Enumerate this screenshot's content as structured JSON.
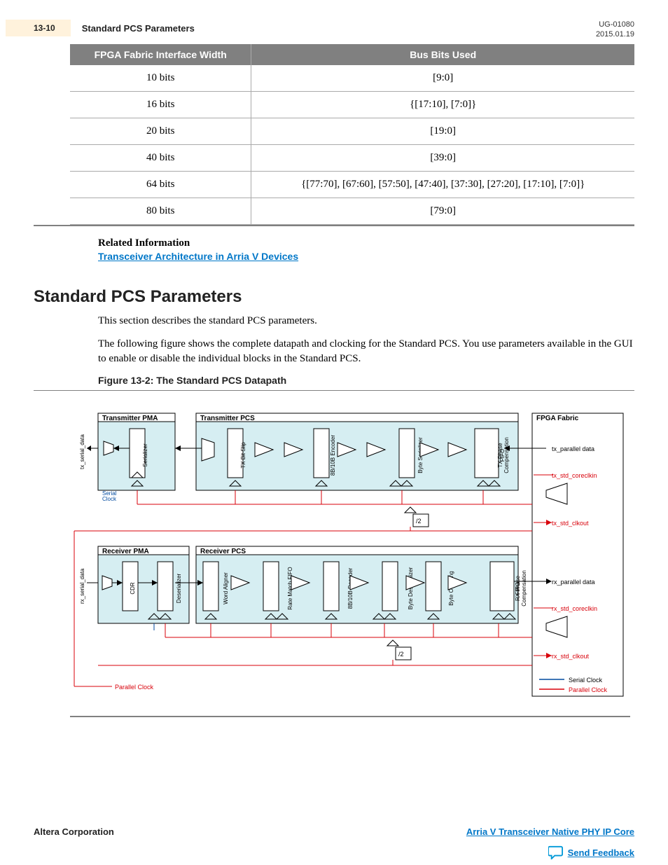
{
  "header": {
    "page_num": "13-10",
    "section_small": "Standard PCS Parameters",
    "doc_id": "UG-01080",
    "doc_date": "2015.01.19"
  },
  "table": {
    "headers": [
      "FPGA Fabric Interface Width",
      "Bus Bits Used"
    ],
    "rows": [
      [
        "10 bits",
        "[9:0]"
      ],
      [
        "16 bits",
        "{[17:10], [7:0]}"
      ],
      [
        "20 bits",
        "[19:0]"
      ],
      [
        "40 bits",
        "[39:0]"
      ],
      [
        "64 bits",
        "{[77:70], [67:60], [57:50], [47:40], [37:30], [27:20], [17:10], [7:0]}"
      ],
      [
        "80 bits",
        "[79:0]"
      ]
    ]
  },
  "related": {
    "heading": "Related Information",
    "link": "Transceiver Architecture in Arria V Devices"
  },
  "section": {
    "title": "Standard PCS Parameters",
    "para1": "This section describes the standard PCS parameters.",
    "para2": "The following figure shows the complete datapath and clocking for the Standard PCS. You use parameters available in the GUI to enable or disable the individual blocks in the Standard PCS."
  },
  "figure": {
    "caption": "Figure 13-2: The Standard PCS Datapath",
    "labels": {
      "tx_pma": "Transmitter PMA",
      "tx_pcs": "Transmitter PCS",
      "fpga_fabric": "FPGA Fabric",
      "rx_pma": "Receiver PMA",
      "rx_pcs": "Receiver PCS",
      "tx_serial_data": "tx_serial_data",
      "rx_serial_data": "rx_serial_data",
      "serializer": "Serializer",
      "tx_bit_slip": "TX Bit Slip",
      "enc_8b10b": "8B/10B Encoder",
      "byte_serializer": "Byte Serializer",
      "tx_phase_fifo": "TX Phase Compensation FIFO",
      "serial_clock": "Serial Clock",
      "parallel_clock": "Parallel Clock",
      "div2": "/2",
      "cdr": "CDR",
      "deserializer": "Deserializer",
      "word_aligner": "Word Aligner",
      "rate_match_fifo": "Rate Match FIFO",
      "dec_8b10b": "8B/10B Decoder",
      "byte_deserializer": "Byte Deserializer",
      "byte_ordering": "Byte Ordering",
      "rx_phase_fifo": "RX Phase Compensation FIFO",
      "tx_parallel_data": "tx_parallel data",
      "tx_std_coreclkin": "tx_std_coreclkin",
      "tx_std_clkout": "tx_std_clkout",
      "rx_parallel_data": "rx_parallel data",
      "rx_std_coreclkin": "rx_std_coreclkin",
      "rx_std_clkout": "rx_std_clkout",
      "legend_serial": "Serial Clock",
      "legend_parallel": "Parallel Clock"
    }
  },
  "footer": {
    "left": "Altera Corporation",
    "right": "Arria V Transceiver Native PHY IP Core",
    "feedback": "Send Feedback"
  }
}
